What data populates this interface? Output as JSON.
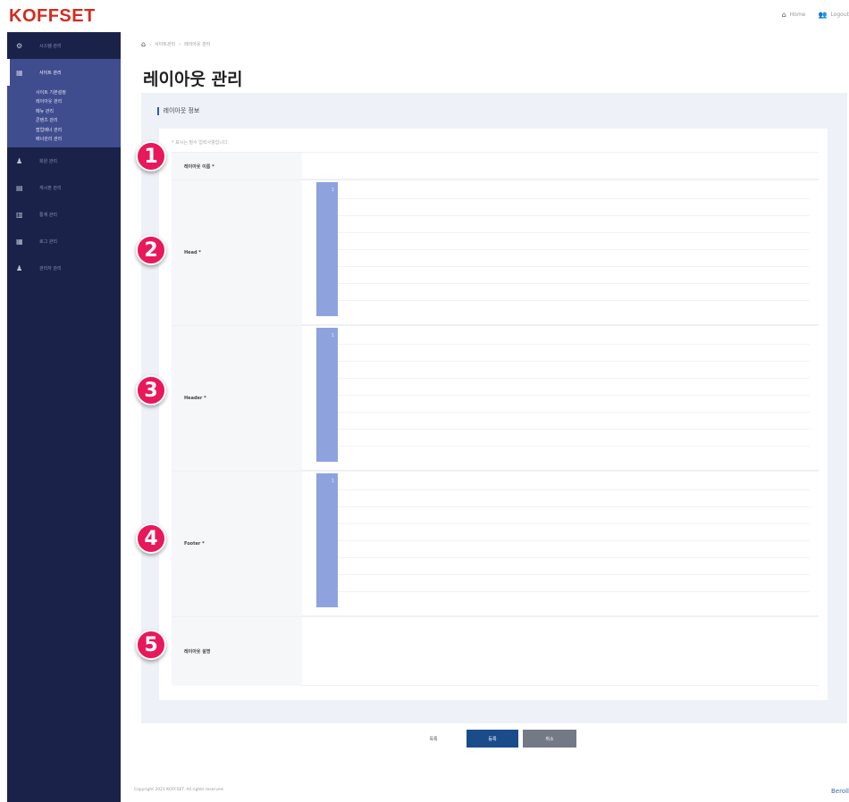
{
  "header": {
    "logo": "KOFFSET",
    "links": [
      {
        "icon": "home-icon",
        "glyph": "⌂",
        "label": "Home"
      },
      {
        "icon": "user-icon",
        "glyph": "👥",
        "label": "Logout"
      }
    ]
  },
  "sidebar": {
    "items": [
      {
        "icon": "settings-icon",
        "glyph": "⚙",
        "label": "시스템 관리",
        "active": false
      },
      {
        "icon": "layout-icon",
        "glyph": "▦",
        "label": "사이트 관리",
        "active": true,
        "sub": [
          "사이트 기본설정",
          "레이아웃 관리",
          "메뉴 관리",
          "콘텐츠 관리",
          "팝업배너 관리",
          "배너관리 관리"
        ]
      },
      {
        "icon": "people-icon",
        "glyph": "♟",
        "label": "회원 관리",
        "active": false
      },
      {
        "icon": "board-icon",
        "glyph": "▤",
        "label": "게시판 관리",
        "active": false
      },
      {
        "icon": "stats-icon",
        "glyph": "▥",
        "label": "통계 관리",
        "active": false
      },
      {
        "icon": "log-icon",
        "glyph": "▦",
        "label": "로그 관리",
        "active": false
      },
      {
        "icon": "admin-icon",
        "glyph": "♟",
        "label": "관리자 관리",
        "active": false
      }
    ]
  },
  "breadcrumb": [
    "사이트관리",
    "레이아웃 관리"
  ],
  "page_title": "레이아웃 관리",
  "section_title": "레이아웃 정보",
  "required_note": "* 표시는 필수 입력사항입니다.",
  "form_rows": [
    {
      "badge": "1",
      "label": "레이아웃 이름 *",
      "type": "text"
    },
    {
      "badge": "2",
      "label": "Head *",
      "type": "editor",
      "gutter_num": "1"
    },
    {
      "badge": "3",
      "label": "Header *",
      "type": "editor",
      "gutter_num": "1"
    },
    {
      "badge": "4",
      "label": "Footer *",
      "type": "editor",
      "gutter_num": "1"
    },
    {
      "badge": "5",
      "label": "레이아웃 설명",
      "type": "textarea"
    }
  ],
  "buttons": {
    "list": "목록",
    "save": "등록",
    "cancel": "취소"
  },
  "footer": {
    "copyright": "Copyright 2021 KOFFSET. All rights reserved.",
    "brand": "Beroll"
  },
  "colors": {
    "sidebar_bg": "#1b2249",
    "sidebar_active": "#3f4c8e",
    "logo": "#d42b1e",
    "badge": "#e8185b",
    "primary_button": "#1a4c8c",
    "editor_gutter": "#8ea3de"
  }
}
